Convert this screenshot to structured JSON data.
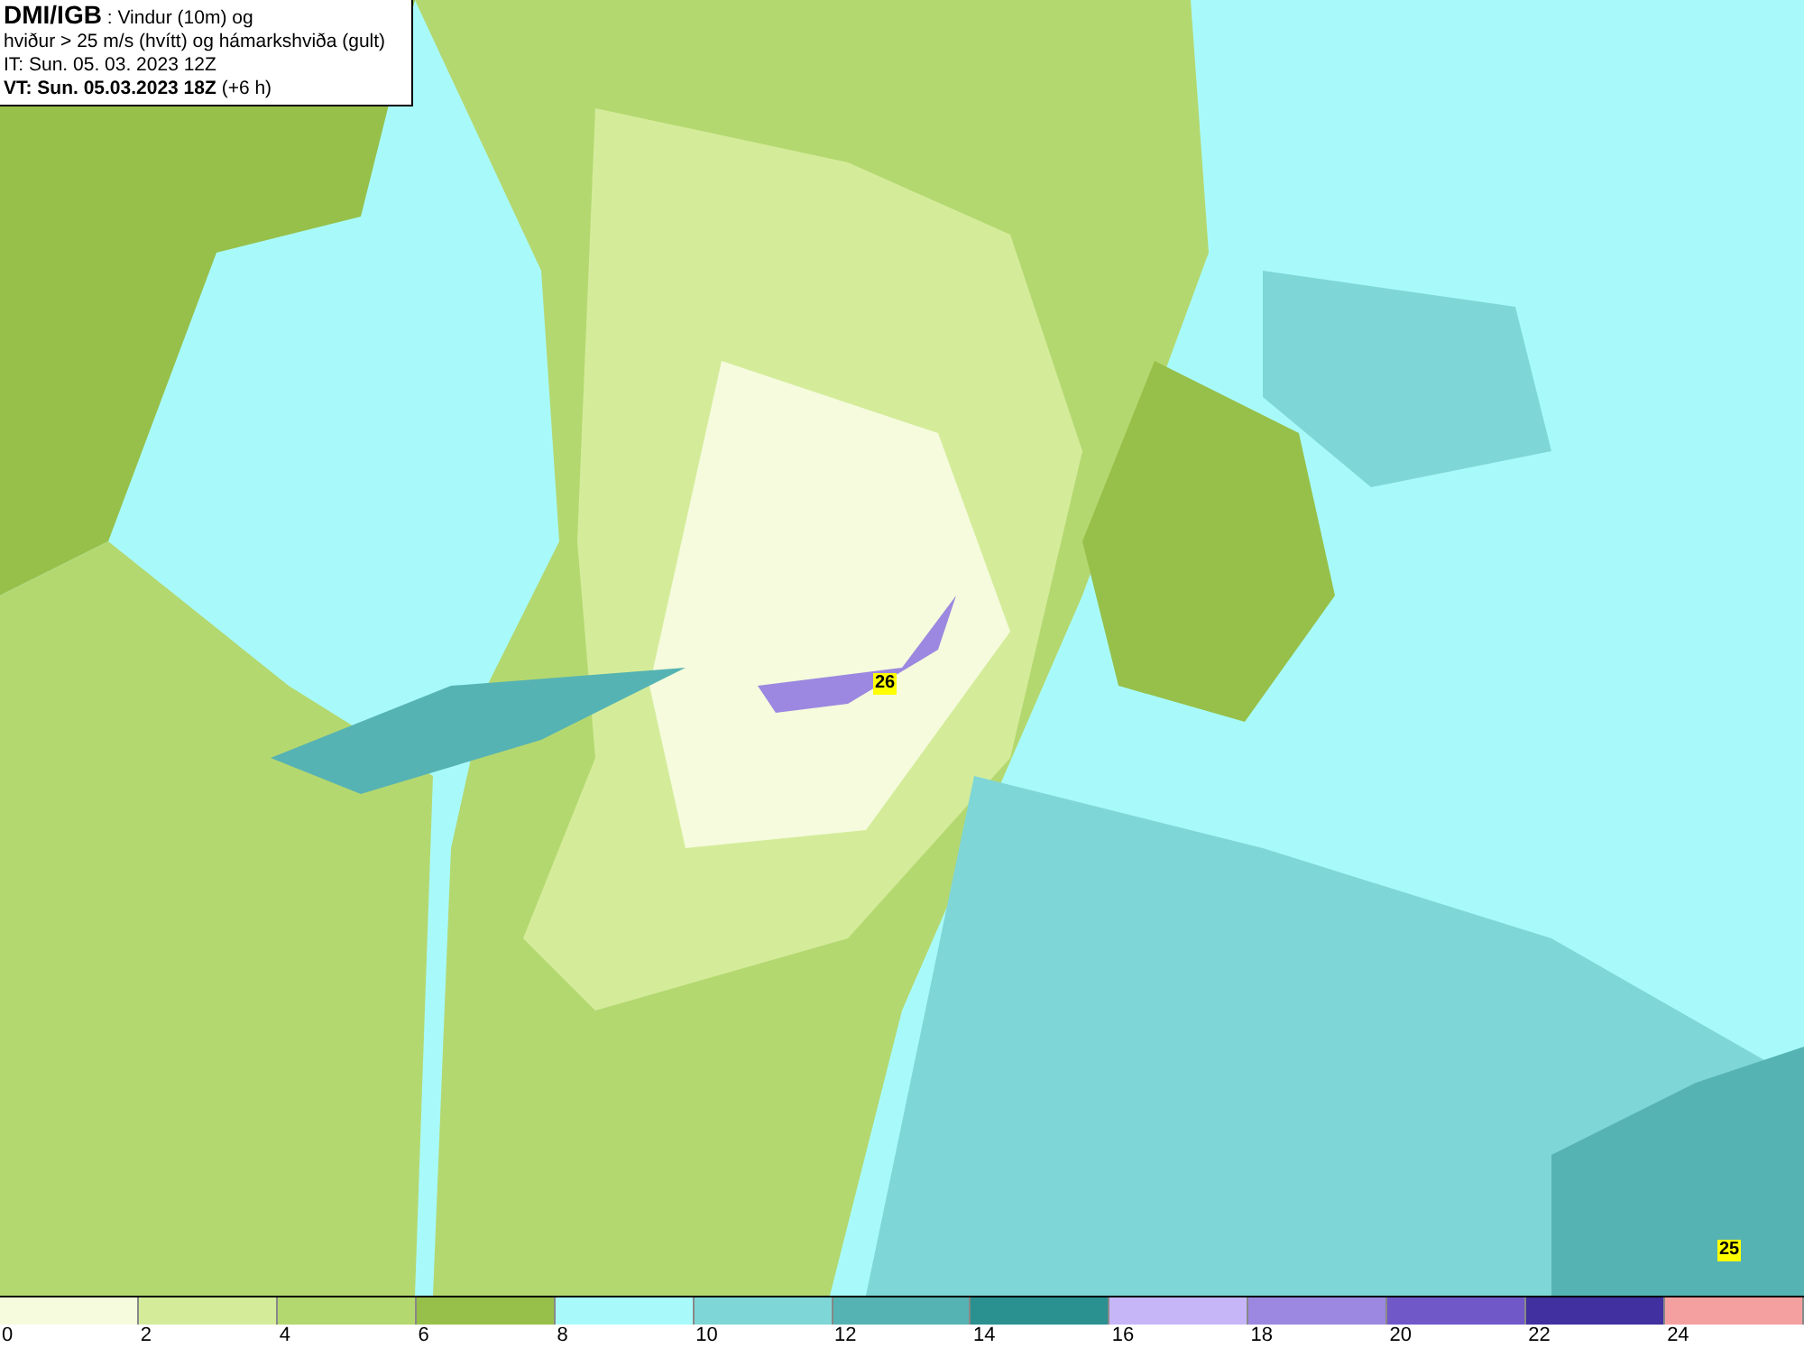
{
  "title_box": {
    "lines": [
      "**DMI/IGB** : Vindur (10m) og",
      "hviður > 25 m/s (hvítt) og hámarkshviða (gult)",
      "IT: Sun. 05. 03. 2023 12Z",
      "**VT: Sun. 05.03.2023 18Z** (+6 h)"
    ]
  },
  "map": {
    "gust_labels": [
      "26",
      "25"
    ]
  },
  "legend": [
    {
      "label": "0",
      "color": "#f5fbdc"
    },
    {
      "label": "2",
      "color": "#d4ec9a"
    },
    {
      "label": "4",
      "color": "#b4d870"
    },
    {
      "label": "6",
      "color": "#97c04a"
    },
    {
      "label": "8",
      "color": "#a8fafa"
    },
    {
      "label": "10",
      "color": "#7fd6d6"
    },
    {
      "label": "12",
      "color": "#56b3b3"
    },
    {
      "label": "14",
      "color": "#2a9090"
    },
    {
      "label": "16",
      "color": "#c6b6f8"
    },
    {
      "label": "18",
      "color": "#9c88e0"
    },
    {
      "label": "20",
      "color": "#7058c8"
    },
    {
      "label": "22",
      "color": "#4030a0"
    },
    {
      "label": "24",
      "color": "#f5a0a0"
    }
  ]
}
